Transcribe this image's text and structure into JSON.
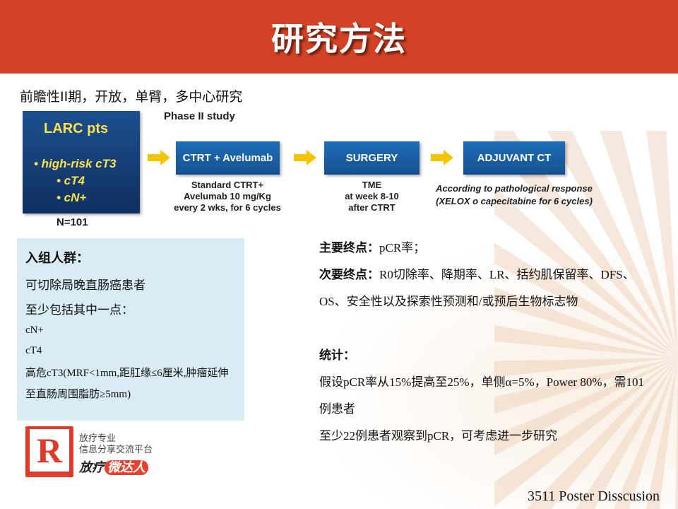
{
  "title": "研究方法",
  "subtitle": "前瞻性II期，开放，单臂，多中心研究",
  "flow": {
    "phase_label": "Phase II study",
    "larc": {
      "title": "LARC pts",
      "items": [
        "• high-risk cT3",
        "• cT4",
        "• cN+"
      ],
      "n": "N=101"
    },
    "ctrt": {
      "label": "CTRT + Avelumab",
      "note": [
        "Standard CTRT+",
        "Avelumab 10 mg/Kg",
        "every 2 wks, for 6 cycles"
      ]
    },
    "surgery": {
      "label": "SURGERY",
      "note": [
        "TME",
        "at week 8-10",
        "after CTRT"
      ]
    },
    "adjuvant": {
      "label": "ADJUVANT CT",
      "note": [
        "According to pathological response",
        "(XELOX o capecitabine for 6 cycles)"
      ]
    },
    "colors": {
      "box": "#1f6fb8",
      "larc_text": "#ffe44a",
      "arrow": "#f5c400"
    }
  },
  "criteria": {
    "heading": "入组人群：",
    "line1": "可切除局晚直肠癌患者",
    "line2": "至少包括其中一点：",
    "item1": "cN+",
    "item2": "cT4",
    "item3": "高危cT3(MRF<1mm,距肛缘≤6厘米,肿瘤延伸至直肠周围脂肪≥5mm)"
  },
  "endpoints": {
    "primary_label": "主要终点：",
    "primary_text": "pCR率；",
    "secondary_label": "次要终点：",
    "secondary_text": "R0切除率、降期率、LR、括约肌保留率、DFS、OS、安全性以及探索性预测和/或预后生物标志物",
    "stats_label": "统计：",
    "stats_line1": "假设pCR率从15%提高至25%，单侧α=5%，Power 80%，需101例患者",
    "stats_line2": "至少22例患者观察到pCR，可考虑进一步研究"
  },
  "logo": {
    "mark": "R",
    "line1": "放疗专业",
    "line2": "信息分享交流平台",
    "name_a": "放疗",
    "name_b": "微达人"
  },
  "footer": "3511 Poster Disscusion",
  "colors": {
    "title_bar": "#d24224",
    "criteria_bg": "#d9ecf4"
  }
}
